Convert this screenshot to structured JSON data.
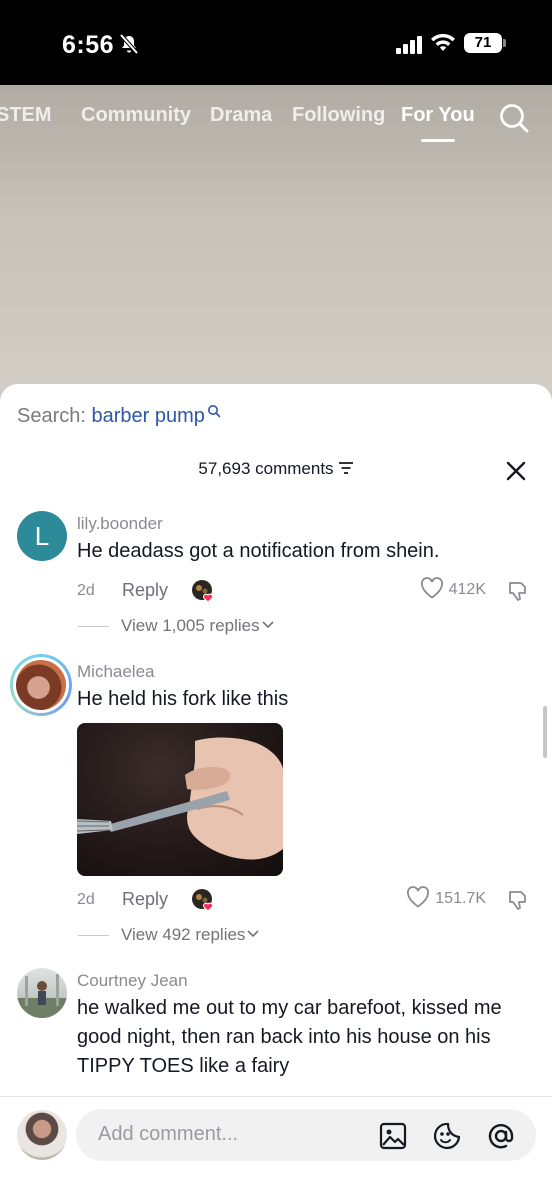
{
  "status_bar": {
    "time": "6:56",
    "battery": "71"
  },
  "tabs": [
    {
      "label": "STEM",
      "active": false
    },
    {
      "label": "Community",
      "active": false
    },
    {
      "label": "Drama",
      "active": false
    },
    {
      "label": "Following",
      "active": false
    },
    {
      "label": "For You",
      "active": true
    }
  ],
  "search": {
    "prefix": "Search:",
    "term": "barber pump"
  },
  "comments_header": {
    "count_label": "57,693 comments"
  },
  "comments": [
    {
      "avatar_letter": "L",
      "username": "lily.boonder",
      "text": "He deadass got a notification from shein.",
      "age": "2d",
      "reply_label": "Reply",
      "likes": "412K",
      "view_replies": "View 1,005 replies"
    },
    {
      "username": "Michaelea",
      "text": "He held his fork like this",
      "age": "2d",
      "reply_label": "Reply",
      "likes": "151.7K",
      "view_replies": "View 492 replies"
    },
    {
      "username": "Courtney Jean",
      "text": "he walked me out to my car barefoot, kissed me good night, then ran back into his house on his TIPPY TOES like a fairy"
    }
  ],
  "composer": {
    "placeholder": "Add comment..."
  },
  "colors": {
    "accent_blue": "#2d57a8",
    "like_gray": "#8a8b91",
    "sheet": "#ffffff"
  }
}
